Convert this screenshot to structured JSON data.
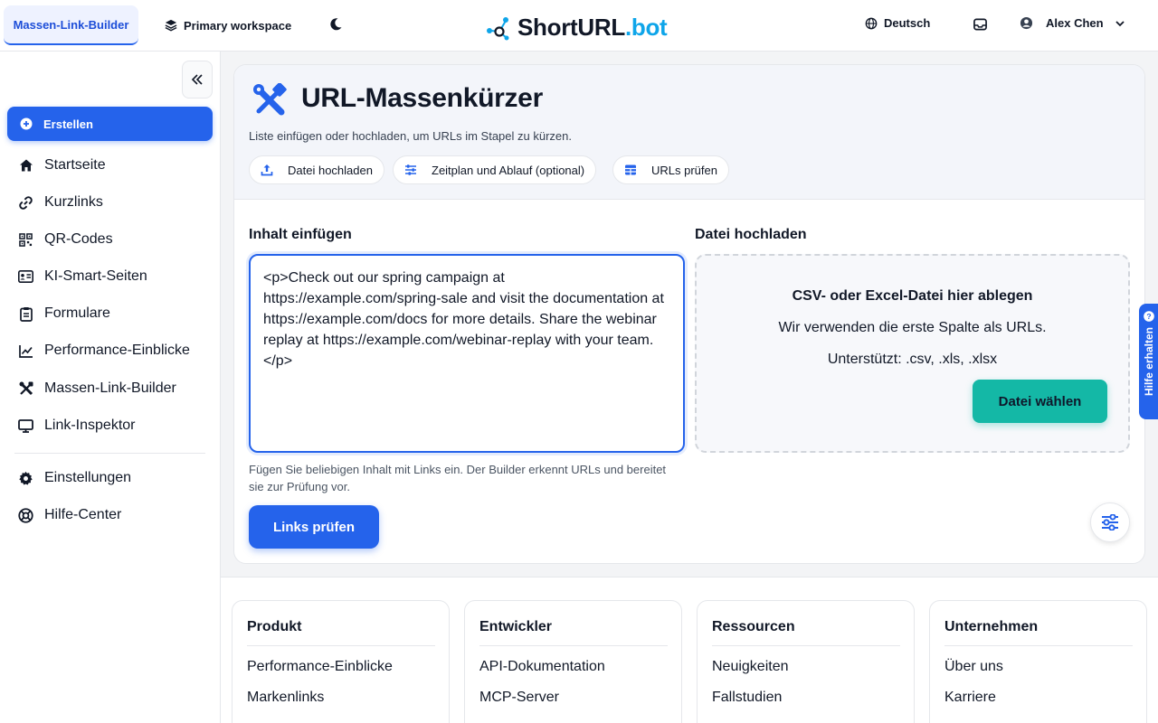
{
  "topbar": {
    "active_tab": "Massen-Link-Builder",
    "workspace": "Primary workspace",
    "logo_short": "Short",
    "logo_url": "URL",
    "logo_bot": ".bot",
    "language": "Deutsch",
    "user_name": "Alex Chen"
  },
  "sidebar": {
    "create": "Erstellen",
    "items": [
      {
        "label": "Startseite",
        "icon": "home-icon"
      },
      {
        "label": "Kurzlinks",
        "icon": "link-icon"
      },
      {
        "label": "QR-Codes",
        "icon": "qr-code-icon"
      },
      {
        "label": "KI-Smart-Seiten",
        "icon": "id-card-icon"
      },
      {
        "label": "Formulare",
        "icon": "clipboard-icon"
      },
      {
        "label": "Performance-Einblicke",
        "icon": "chart-line-icon"
      },
      {
        "label": "Massen-Link-Builder",
        "icon": "tools-icon"
      },
      {
        "label": "Link-Inspektor",
        "icon": "monitor-icon"
      }
    ],
    "bottom_items": [
      {
        "label": "Einstellungen",
        "icon": "gear-icon"
      },
      {
        "label": "Hilfe-Center",
        "icon": "lifebuoy-icon"
      }
    ]
  },
  "main": {
    "title": "URL-Massenkürzer",
    "subtitle": "Liste einfügen oder hochladen, um URLs im Stapel zu kürzen.",
    "pills": [
      "Datei hochladen",
      "Zeitplan und Ablauf (optional)",
      "URLs prüfen"
    ],
    "paste_label": "Inhalt einfügen",
    "paste_value": "<p>Check out our spring campaign at https://example.com/spring-sale and visit the documentation at https://example.com/docs for more details. Share the webinar replay at https://example.com/webinar-replay with your team.</p>",
    "paste_hint": "Fügen Sie beliebigen Inhalt mit Links ein. Der Builder erkennt URLs und bereitet sie zur Prüfung vor.",
    "check_button": "Links prüfen",
    "upload_label": "Datei hochladen",
    "dropzone_title": "CSV- oder Excel-Datei hier ablegen",
    "dropzone_line1": "Wir verwenden die erste Spalte als URLs.",
    "dropzone_line2": "Unterstützt: .csv, .xls, .xlsx",
    "choose_button": "Datei wählen"
  },
  "help_tab": "Hilfe erhalten",
  "footer": {
    "columns": [
      {
        "title": "Produkt",
        "links": [
          "Performance-Einblicke",
          "Markenlinks"
        ]
      },
      {
        "title": "Entwickler",
        "links": [
          "API-Dokumentation",
          "MCP-Server"
        ]
      },
      {
        "title": "Ressourcen",
        "links": [
          "Neuigkeiten",
          "Fallstudien"
        ]
      },
      {
        "title": "Unternehmen",
        "links": [
          "Über uns",
          "Karriere"
        ]
      }
    ]
  },
  "colors": {
    "primary": "#2563eb",
    "teal": "#14b8a6",
    "logo_accent": "#0ea5e9"
  }
}
